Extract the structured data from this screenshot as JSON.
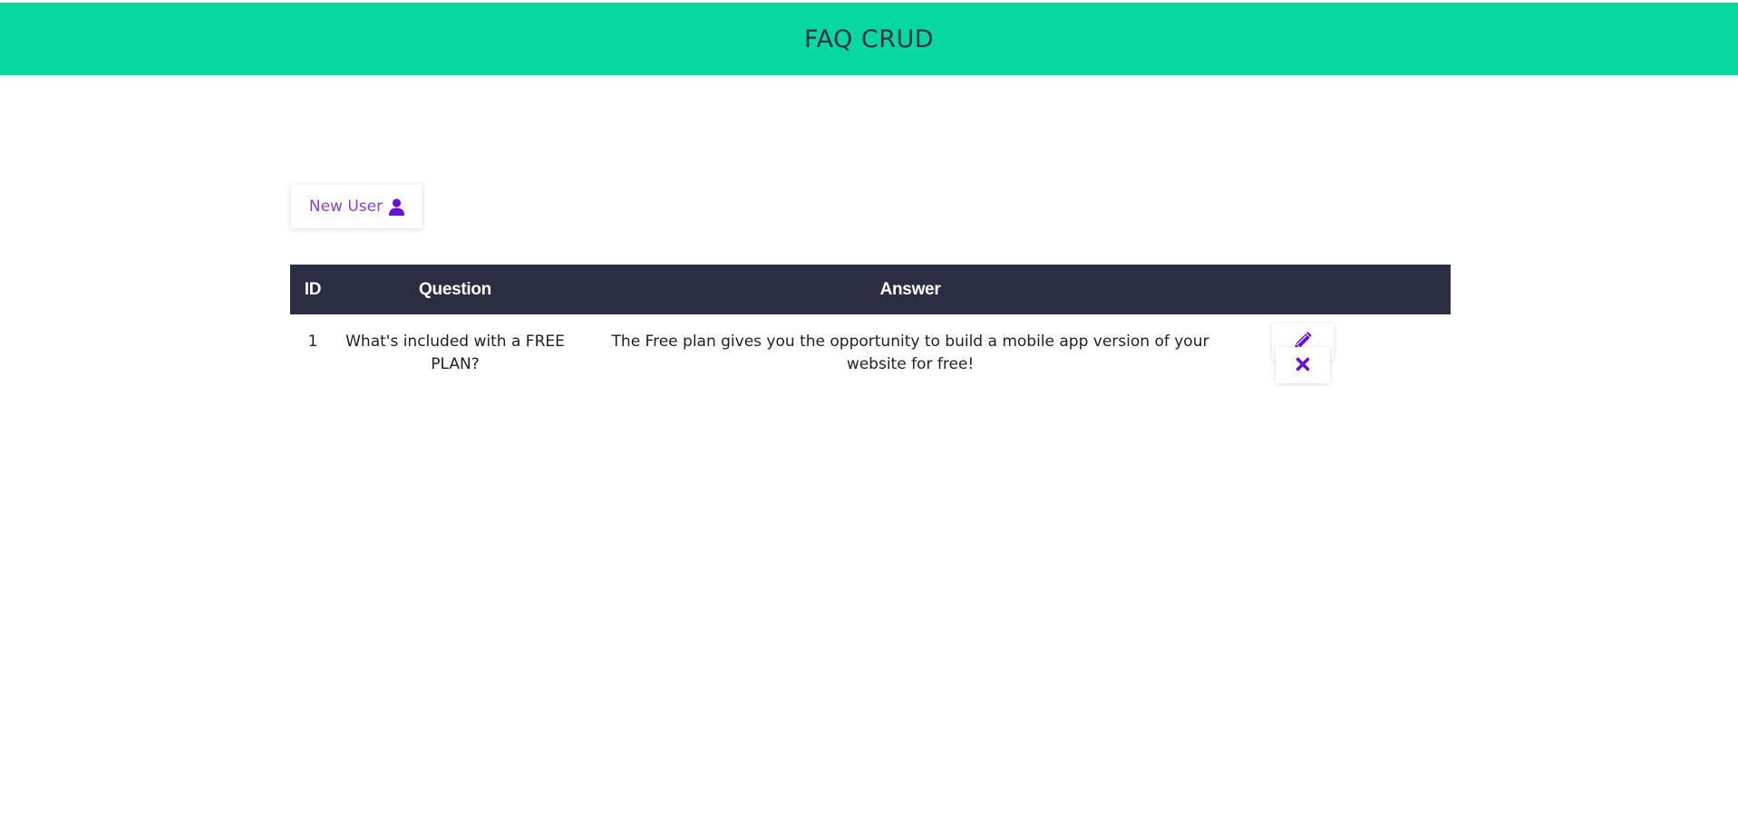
{
  "header": {
    "title": "FAQ CRUD"
  },
  "toolbar": {
    "new_user_label": "New User",
    "new_user_icon": "user-icon"
  },
  "table": {
    "columns": [
      "ID",
      "Question",
      "Answer",
      ""
    ],
    "rows": [
      {
        "id": "1",
        "question": "What's included with a FREE PLAN?",
        "answer": "The Free plan gives you the opportunity to build a mobile app version of your website for free!",
        "actions": [
          "pencil-icon",
          "close-icon"
        ]
      }
    ]
  },
  "colors": {
    "header_bg": "#07d8a0",
    "header_text": "#2c2f45",
    "table_header_bg": "#2b2d42",
    "accent": "#8e3dd8",
    "icon": "#6a11d8"
  }
}
